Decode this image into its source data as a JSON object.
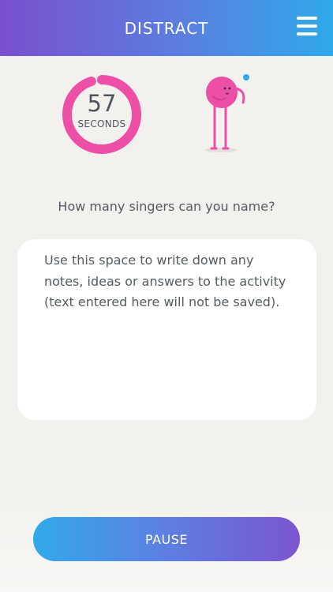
{
  "header": {
    "title": "DISTRACT",
    "menu_icon": "hamburger-menu-icon"
  },
  "timer": {
    "value": "57",
    "unit": "SECONDS",
    "remaining_fraction": 0.95
  },
  "mascot": {
    "icon": "pink-character-icon"
  },
  "prompt": "How many singers can you name?",
  "notes": {
    "placeholder": "Use this space to write down any notes, ideas or answers to the activity (text entered here will not be saved)."
  },
  "pause_button": {
    "label": "PAUSE"
  },
  "colors": {
    "accent_pink": "#ee4fa6",
    "accent_blue": "#2fa9ec",
    "accent_purple": "#7a4fcf"
  }
}
